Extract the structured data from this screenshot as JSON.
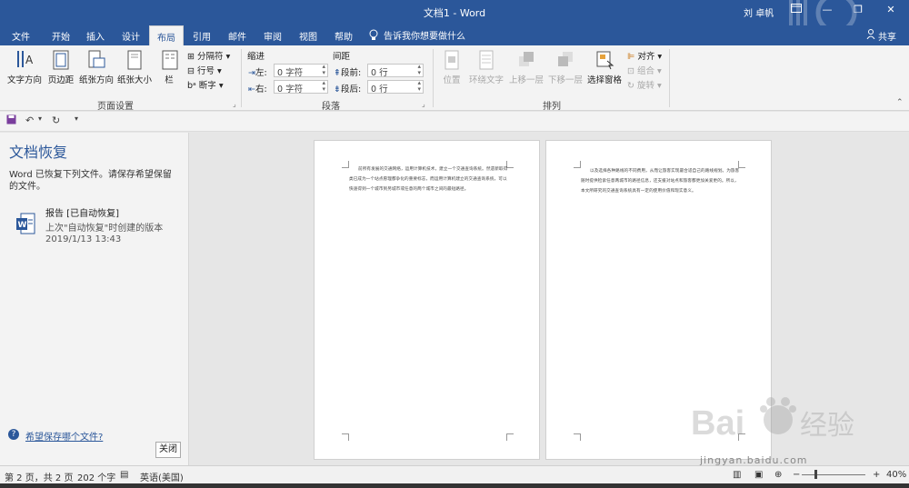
{
  "titlebar": {
    "title": "文档1 - Word",
    "user": "刘 卓帆",
    "minimize": "—",
    "restore": "❐",
    "close": "✕"
  },
  "tabs": {
    "file": "文件",
    "home": "开始",
    "insert": "插入",
    "design": "设计",
    "layout": "布局",
    "references": "引用",
    "mailings": "邮件",
    "review": "审阅",
    "view": "视图",
    "help": "帮助",
    "tellme": "告诉我你想要做什么",
    "share": "共享"
  },
  "ribbon": {
    "page_setup": {
      "text_direction": "文字方向",
      "margins": "页边距",
      "orientation": "纸张方向",
      "size": "纸张大小",
      "columns": "栏",
      "breaks": "分隔符",
      "line_numbers": "行号",
      "hyphenation": "断字",
      "label": "页面设置"
    },
    "paragraph": {
      "indent_title": "缩进",
      "spacing_title": "间距",
      "left_label": "左:",
      "right_label": "右:",
      "before_label": "段前:",
      "after_label": "段后:",
      "left_value": "0 字符",
      "right_value": "0 字符",
      "before_value": "0 行",
      "after_value": "0 行",
      "label": "段落"
    },
    "arrange": {
      "position": "位置",
      "wrap_text": "环绕文字",
      "bring_forward": "上移一层",
      "send_backward": "下移一层",
      "selection_pane": "选择窗格",
      "align": "对齐",
      "group": "组合",
      "rotate": "旋转",
      "label": "排列"
    }
  },
  "recovery": {
    "title": "文档恢复",
    "description": "Word 已恢复下列文件。请保存希望保留的文件。",
    "file_name": "报告 [已自动恢复]",
    "file_subtitle": "上次\"自动恢复\"时创建的版本",
    "file_date": "2019/1/13 13:43",
    "help_link": "希望保存哪个文件?",
    "close_button": "关闭"
  },
  "pages": {
    "page1_text": "前所有发展的交通网络，运用计算机技术，建立一个交通查询系统。然遗新取得类已成为一个站点愿理都争化的重要标志，而运用计算机建立的交通查询系统，可以快速得到一个城市到另城市或任意的两个城市之间的最短路径。",
    "page2_text": "以及选择各种路线的不同费用，从而让旅客实现最合适自己的路线规划。为旅客随时提供检索任意两城市的路径信息，还支援对站点和旅客都更加关爱更的。所以，本文所研究的交通查询系统具有一定的使用价值和现实意义。"
  },
  "statusbar": {
    "page": "第 2 页，共 2 页",
    "words": "202 个字",
    "language": "英语(美国)",
    "zoom": "40%",
    "zoom_minus": "−",
    "zoom_plus": "+"
  },
  "watermark": {
    "url": "jingyan.baidu.com"
  },
  "colors": {
    "accent": "#2b579a",
    "ribbon_bg": "#f3f3f3",
    "doc_bg": "#e6e6e6"
  }
}
